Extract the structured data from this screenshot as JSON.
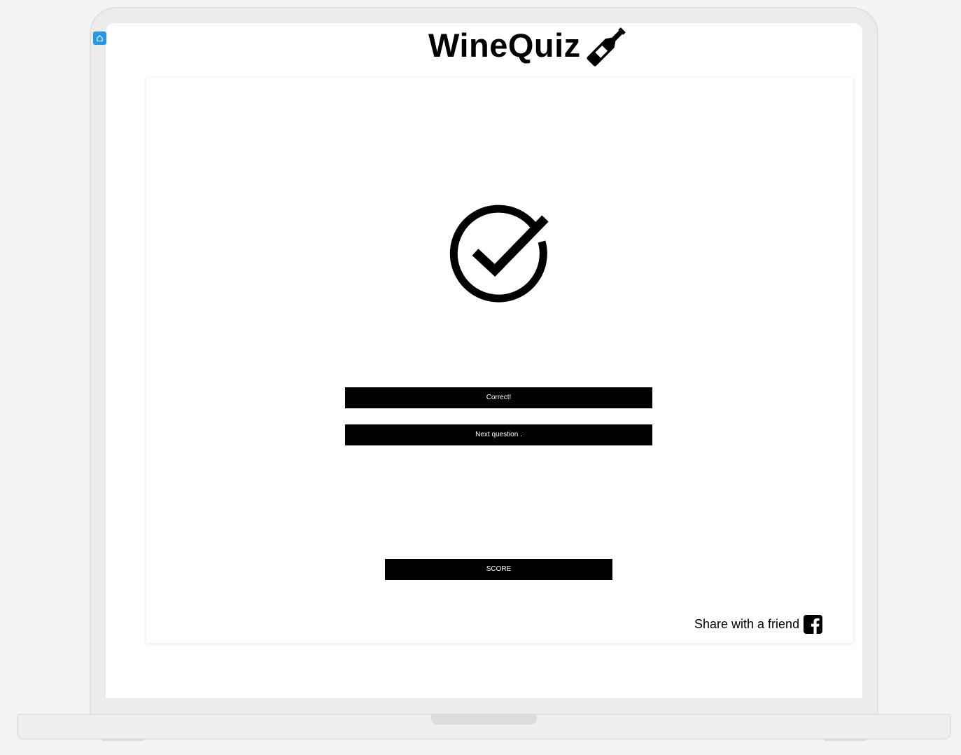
{
  "app": {
    "title": "WineQuiz",
    "icon": "wine-bottle-icon"
  },
  "nav": {
    "home_icon": "home-icon",
    "accent_color": "#2196f3"
  },
  "result": {
    "status_icon": "check-circle-icon",
    "message": "Correct!"
  },
  "actions": {
    "next_label": "Next question .",
    "score_label": "SCORE"
  },
  "share": {
    "label": "Share with a friend",
    "icon": "facebook-icon"
  },
  "colors": {
    "primary": "#000000",
    "background": "#ffffff",
    "page_background": "#f4f4f4"
  }
}
